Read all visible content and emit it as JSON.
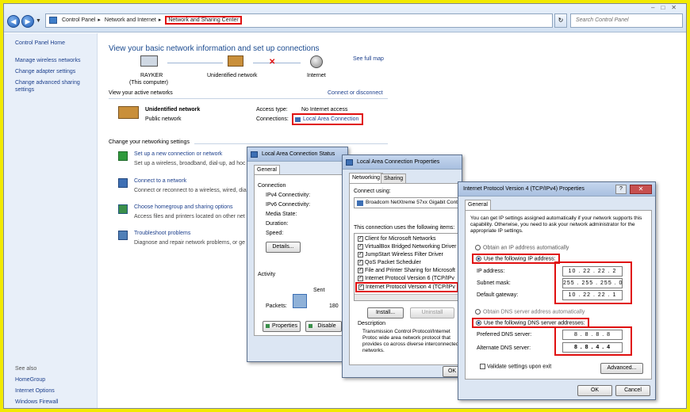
{
  "address_bar": {
    "breadcrumbs": [
      "Control Panel",
      "Network and Internet",
      "Network and Sharing Center"
    ],
    "search_placeholder": "Search Control Panel"
  },
  "sidebar": {
    "top_items": [
      "Control Panel Home",
      "Manage wireless networks",
      "Change adapter settings",
      "Change advanced sharing settings"
    ],
    "see_also_label": "See also",
    "bottom_items": [
      "HomeGroup",
      "Internet Options",
      "Windows Firewall"
    ]
  },
  "main": {
    "title": "View your basic network information and set up connections",
    "see_full_map": "See full map",
    "map": {
      "computer_name": "RAYKER",
      "computer_sub": "(This computer)",
      "network_label": "Unidentified network",
      "internet_label": "Internet"
    },
    "active_networks_label": "View your active networks",
    "connect_disconnect": "Connect or disconnect",
    "network_name": "Unidentified network",
    "network_type": "Public network",
    "access_type_label": "Access type:",
    "access_type_value": "No Internet access",
    "connections_label": "Connections:",
    "connection_link": "Local Area Connection",
    "change_settings_label": "Change your networking settings",
    "tasks": [
      {
        "title": "Set up a new connection or network",
        "desc": "Set up a wireless, broadband, dial-up, ad hoc"
      },
      {
        "title": "Connect to a network",
        "desc": "Connect or reconnect to a wireless, wired, dia"
      },
      {
        "title": "Choose homegroup and sharing options",
        "desc": "Access files and printers located on other net"
      },
      {
        "title": "Troubleshoot problems",
        "desc": "Diagnose and repair network problems, or ge"
      }
    ]
  },
  "status_dialog": {
    "title": "Local Area Connection Status",
    "tab": "General",
    "connection_group": "Connection",
    "fields": [
      "IPv4 Connectivity:",
      "IPv6 Connectivity:",
      "Media State:",
      "Duration:",
      "Speed:"
    ],
    "details_button": "Details...",
    "activity_group": "Activity",
    "sent_label": "Sent",
    "packets_label": "Packets:",
    "packets_value": "180",
    "properties_button": "Properties",
    "disable_button": "Disable"
  },
  "properties_dialog": {
    "title": "Local Area Connection Properties",
    "tabs": [
      "Networking",
      "Sharing"
    ],
    "connect_using_label": "Connect using:",
    "adapter": "Broadcom NetXtreme 57xx Gigabit Cont",
    "items_label": "This connection uses the following items:",
    "items": [
      "Client for Microsoft Networks",
      "VirtualBox Bridged Networking Driver",
      "JumpStart Wireless Filter Driver",
      "QoS Packet Scheduler",
      "File and Printer Sharing for Microsoft",
      "Internet Protocol Version 6 (TCP/IPv",
      "Internet Protocol Version 4 (TCP/IPv"
    ],
    "install_button": "Install...",
    "uninstall_button": "Uninstall",
    "description_label": "Description",
    "description_text": "Transmission Control Protocol/Internet Protoc wide area network protocol that provides co across diverse interconnected networks.",
    "ok_button": "OK"
  },
  "ipv4_dialog": {
    "title": "Internet Protocol Version 4 (TCP/IPv4) Properties",
    "help_glyph": "?",
    "tab": "General",
    "intro": "You can get IP settings assigned automatically if your network supports this capability. Otherwise, you need to ask your network administrator for the appropriate IP settings.",
    "auto_ip": "Obtain an IP address automatically",
    "use_ip": "Use the following IP address:",
    "ip_label": "IP address:",
    "ip_value": "10 . 22 . 22 . 2",
    "mask_label": "Subnet mask:",
    "mask_value": "255 . 255 . 255 . 0",
    "gateway_label": "Default gateway:",
    "gateway_value": "10 . 22 . 22 . 1",
    "auto_dns": "Obtain DNS server address automatically",
    "use_dns": "Use the following DNS server addresses:",
    "pref_dns_label": "Preferred DNS server:",
    "pref_dns_value": "8 . 8 . 8 . 8",
    "alt_dns_label": "Alternate DNS server:",
    "alt_dns_value": "8 . 8 . 4 . 4",
    "validate_label": "Validate settings upon exit",
    "advanced_button": "Advanced...",
    "ok_button": "OK",
    "cancel_button": "Cancel"
  }
}
